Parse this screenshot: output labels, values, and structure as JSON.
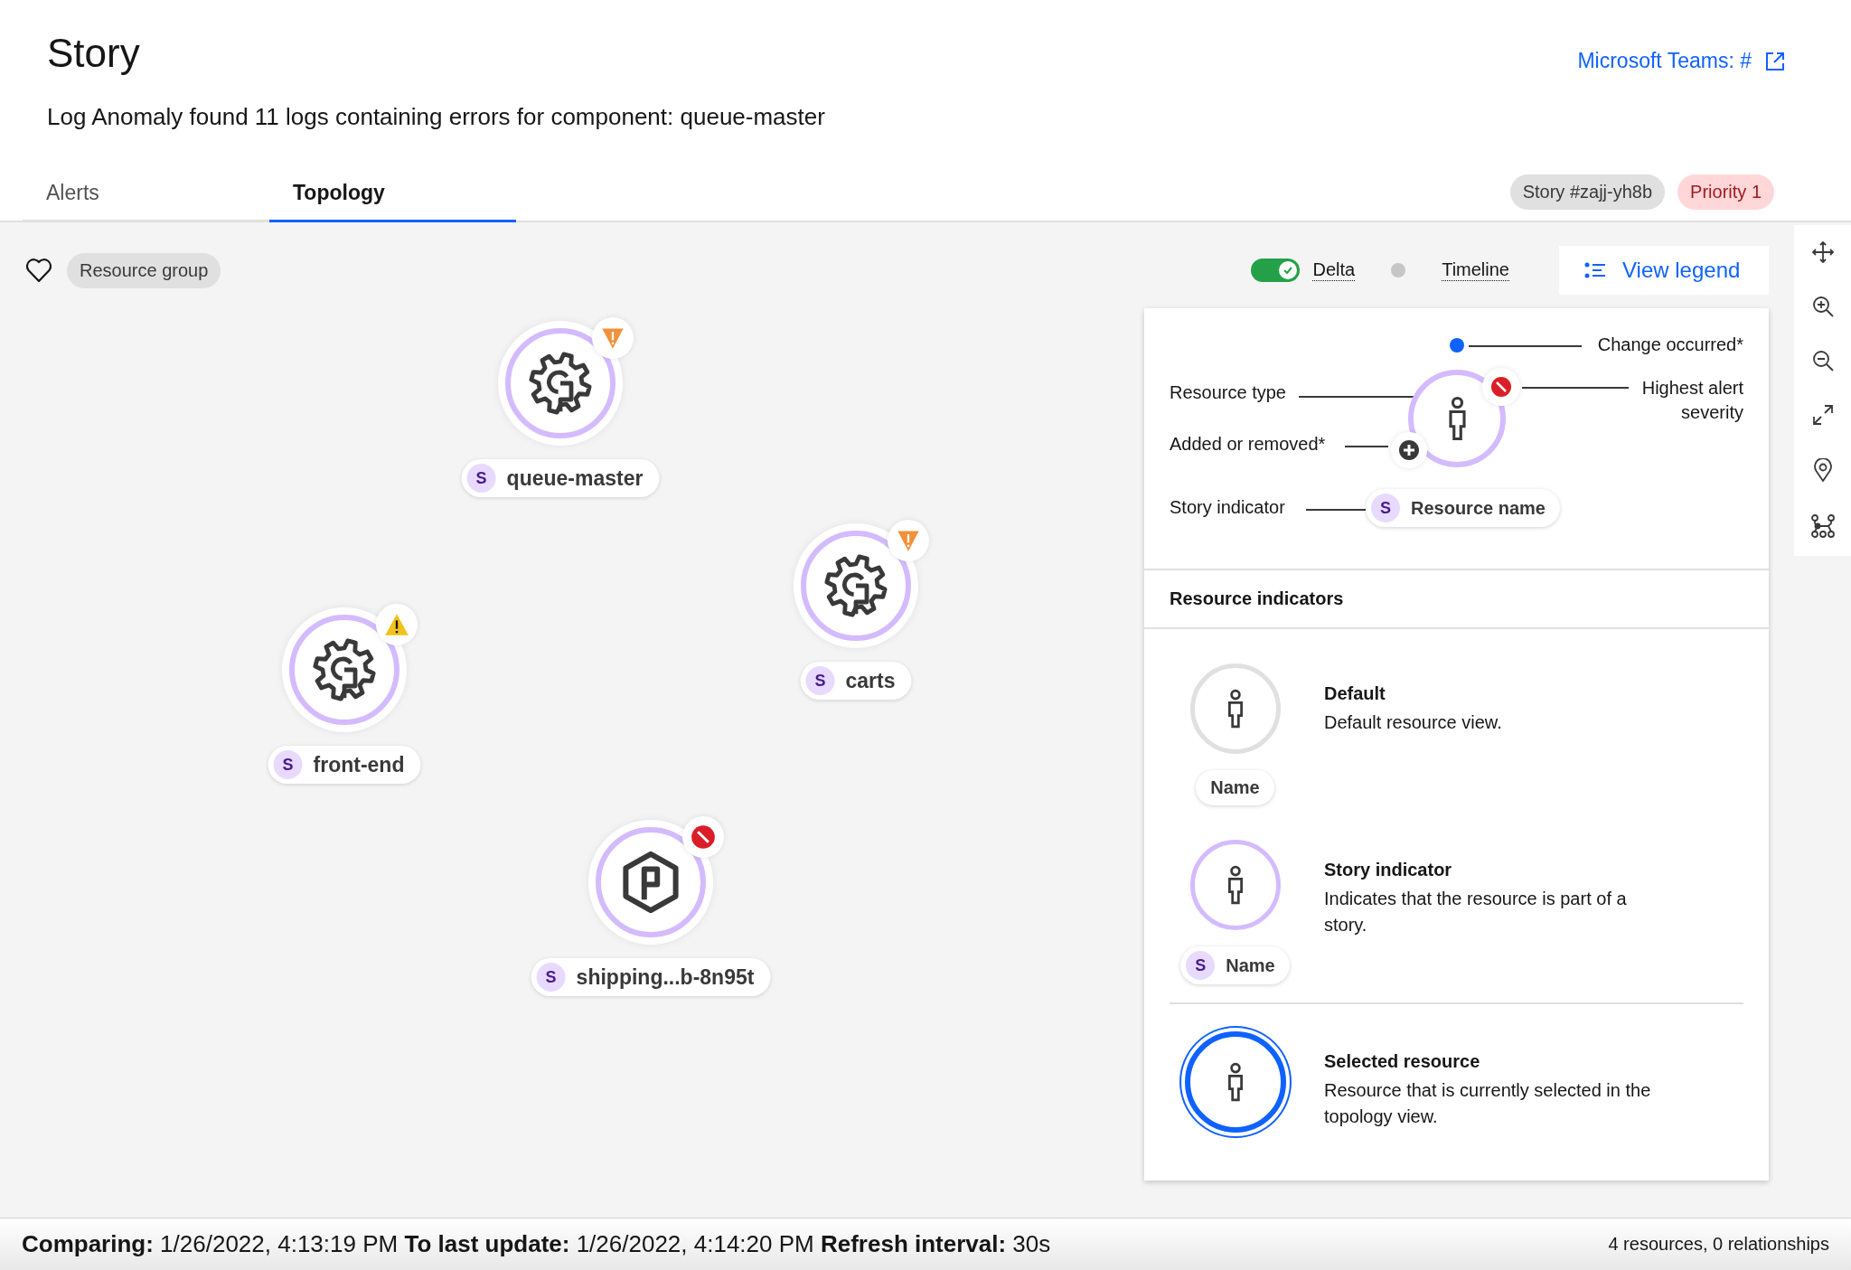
{
  "header": {
    "title": "Story",
    "subtitle": "Log Anomaly found 11 logs containing errors for component: queue-master",
    "link": "Microsoft Teams: #"
  },
  "tabs": [
    {
      "label": "Alerts",
      "selected": false
    },
    {
      "label": "Topology",
      "selected": true
    }
  ],
  "tags": [
    {
      "label": "Story #zajj-yh8b",
      "kind": "neutral"
    },
    {
      "label": "Priority 1",
      "kind": "priority"
    }
  ],
  "toolbar": {
    "resource_group": "Resource group",
    "delta": {
      "label": "Delta",
      "on": true
    },
    "timeline": {
      "label": "Timeline",
      "on": false
    },
    "legend_button": "View legend"
  },
  "nodes": [
    {
      "name": "queue-master",
      "kind": "service",
      "alert": {
        "kind": "major"
      },
      "badge": "S"
    },
    {
      "name": "carts",
      "kind": "service",
      "alert": {
        "kind": "major"
      },
      "badge": "S"
    },
    {
      "name": "front-end",
      "kind": "service",
      "alert": {
        "kind": "minor"
      },
      "badge": "S"
    },
    {
      "name": "shipping...b-8n95t",
      "kind": "pod",
      "alert": {
        "kind": "critical"
      },
      "badge": "S"
    }
  ],
  "legend": {
    "diagram": {
      "change": "Change occurred*",
      "type": "Resource type",
      "severity": "Highest alert severity",
      "added": "Added or removed*",
      "story": "Story indicator",
      "badge": "S",
      "resource_name": "Resource name"
    },
    "section_title": "Resource indicators",
    "items": [
      {
        "kind": "default",
        "title": "Default",
        "description": "Default resource view.",
        "name": "Name"
      },
      {
        "kind": "story",
        "title": "Story indicator",
        "description": "Indicates that the resource is part of a story.",
        "badge": "S",
        "name": "Name"
      },
      {
        "kind": "selected",
        "title": "Selected resource",
        "description": "Resource that is currently selected in the topology view."
      }
    ]
  },
  "status_bar": {
    "text": "**Comparing:** 1/26/2022, 4:13:19 PM **To last update:** 1/26/2022, 4:14:20 PM **Refresh interval:** 30s",
    "summary": "4 resources, 0 relationships"
  }
}
